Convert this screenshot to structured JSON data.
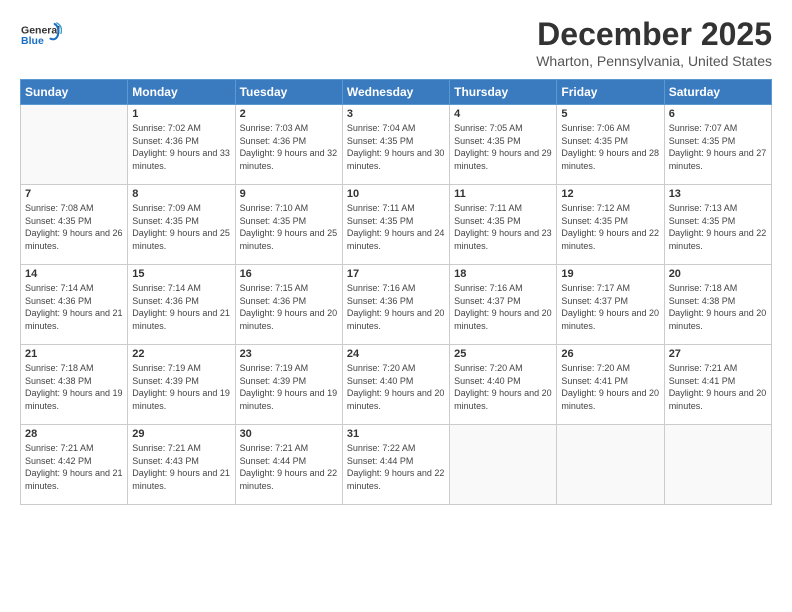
{
  "header": {
    "logo_general": "General",
    "logo_blue": "Blue",
    "month_title": "December 2025",
    "location": "Wharton, Pennsylvania, United States"
  },
  "columns": [
    "Sunday",
    "Monday",
    "Tuesday",
    "Wednesday",
    "Thursday",
    "Friday",
    "Saturday"
  ],
  "weeks": [
    [
      {
        "day": "",
        "sunrise": "",
        "sunset": "",
        "daylight": ""
      },
      {
        "day": "1",
        "sunrise": "Sunrise: 7:02 AM",
        "sunset": "Sunset: 4:36 PM",
        "daylight": "Daylight: 9 hours and 33 minutes."
      },
      {
        "day": "2",
        "sunrise": "Sunrise: 7:03 AM",
        "sunset": "Sunset: 4:36 PM",
        "daylight": "Daylight: 9 hours and 32 minutes."
      },
      {
        "day": "3",
        "sunrise": "Sunrise: 7:04 AM",
        "sunset": "Sunset: 4:35 PM",
        "daylight": "Daylight: 9 hours and 30 minutes."
      },
      {
        "day": "4",
        "sunrise": "Sunrise: 7:05 AM",
        "sunset": "Sunset: 4:35 PM",
        "daylight": "Daylight: 9 hours and 29 minutes."
      },
      {
        "day": "5",
        "sunrise": "Sunrise: 7:06 AM",
        "sunset": "Sunset: 4:35 PM",
        "daylight": "Daylight: 9 hours and 28 minutes."
      },
      {
        "day": "6",
        "sunrise": "Sunrise: 7:07 AM",
        "sunset": "Sunset: 4:35 PM",
        "daylight": "Daylight: 9 hours and 27 minutes."
      }
    ],
    [
      {
        "day": "7",
        "sunrise": "Sunrise: 7:08 AM",
        "sunset": "Sunset: 4:35 PM",
        "daylight": "Daylight: 9 hours and 26 minutes."
      },
      {
        "day": "8",
        "sunrise": "Sunrise: 7:09 AM",
        "sunset": "Sunset: 4:35 PM",
        "daylight": "Daylight: 9 hours and 25 minutes."
      },
      {
        "day": "9",
        "sunrise": "Sunrise: 7:10 AM",
        "sunset": "Sunset: 4:35 PM",
        "daylight": "Daylight: 9 hours and 25 minutes."
      },
      {
        "day": "10",
        "sunrise": "Sunrise: 7:11 AM",
        "sunset": "Sunset: 4:35 PM",
        "daylight": "Daylight: 9 hours and 24 minutes."
      },
      {
        "day": "11",
        "sunrise": "Sunrise: 7:11 AM",
        "sunset": "Sunset: 4:35 PM",
        "daylight": "Daylight: 9 hours and 23 minutes."
      },
      {
        "day": "12",
        "sunrise": "Sunrise: 7:12 AM",
        "sunset": "Sunset: 4:35 PM",
        "daylight": "Daylight: 9 hours and 22 minutes."
      },
      {
        "day": "13",
        "sunrise": "Sunrise: 7:13 AM",
        "sunset": "Sunset: 4:35 PM",
        "daylight": "Daylight: 9 hours and 22 minutes."
      }
    ],
    [
      {
        "day": "14",
        "sunrise": "Sunrise: 7:14 AM",
        "sunset": "Sunset: 4:36 PM",
        "daylight": "Daylight: 9 hours and 21 minutes."
      },
      {
        "day": "15",
        "sunrise": "Sunrise: 7:14 AM",
        "sunset": "Sunset: 4:36 PM",
        "daylight": "Daylight: 9 hours and 21 minutes."
      },
      {
        "day": "16",
        "sunrise": "Sunrise: 7:15 AM",
        "sunset": "Sunset: 4:36 PM",
        "daylight": "Daylight: 9 hours and 20 minutes."
      },
      {
        "day": "17",
        "sunrise": "Sunrise: 7:16 AM",
        "sunset": "Sunset: 4:36 PM",
        "daylight": "Daylight: 9 hours and 20 minutes."
      },
      {
        "day": "18",
        "sunrise": "Sunrise: 7:16 AM",
        "sunset": "Sunset: 4:37 PM",
        "daylight": "Daylight: 9 hours and 20 minutes."
      },
      {
        "day": "19",
        "sunrise": "Sunrise: 7:17 AM",
        "sunset": "Sunset: 4:37 PM",
        "daylight": "Daylight: 9 hours and 20 minutes."
      },
      {
        "day": "20",
        "sunrise": "Sunrise: 7:18 AM",
        "sunset": "Sunset: 4:38 PM",
        "daylight": "Daylight: 9 hours and 20 minutes."
      }
    ],
    [
      {
        "day": "21",
        "sunrise": "Sunrise: 7:18 AM",
        "sunset": "Sunset: 4:38 PM",
        "daylight": "Daylight: 9 hours and 19 minutes."
      },
      {
        "day": "22",
        "sunrise": "Sunrise: 7:19 AM",
        "sunset": "Sunset: 4:39 PM",
        "daylight": "Daylight: 9 hours and 19 minutes."
      },
      {
        "day": "23",
        "sunrise": "Sunrise: 7:19 AM",
        "sunset": "Sunset: 4:39 PM",
        "daylight": "Daylight: 9 hours and 19 minutes."
      },
      {
        "day": "24",
        "sunrise": "Sunrise: 7:20 AM",
        "sunset": "Sunset: 4:40 PM",
        "daylight": "Daylight: 9 hours and 20 minutes."
      },
      {
        "day": "25",
        "sunrise": "Sunrise: 7:20 AM",
        "sunset": "Sunset: 4:40 PM",
        "daylight": "Daylight: 9 hours and 20 minutes."
      },
      {
        "day": "26",
        "sunrise": "Sunrise: 7:20 AM",
        "sunset": "Sunset: 4:41 PM",
        "daylight": "Daylight: 9 hours and 20 minutes."
      },
      {
        "day": "27",
        "sunrise": "Sunrise: 7:21 AM",
        "sunset": "Sunset: 4:41 PM",
        "daylight": "Daylight: 9 hours and 20 minutes."
      }
    ],
    [
      {
        "day": "28",
        "sunrise": "Sunrise: 7:21 AM",
        "sunset": "Sunset: 4:42 PM",
        "daylight": "Daylight: 9 hours and 21 minutes."
      },
      {
        "day": "29",
        "sunrise": "Sunrise: 7:21 AM",
        "sunset": "Sunset: 4:43 PM",
        "daylight": "Daylight: 9 hours and 21 minutes."
      },
      {
        "day": "30",
        "sunrise": "Sunrise: 7:21 AM",
        "sunset": "Sunset: 4:44 PM",
        "daylight": "Daylight: 9 hours and 22 minutes."
      },
      {
        "day": "31",
        "sunrise": "Sunrise: 7:22 AM",
        "sunset": "Sunset: 4:44 PM",
        "daylight": "Daylight: 9 hours and 22 minutes."
      },
      {
        "day": "",
        "sunrise": "",
        "sunset": "",
        "daylight": ""
      },
      {
        "day": "",
        "sunrise": "",
        "sunset": "",
        "daylight": ""
      },
      {
        "day": "",
        "sunrise": "",
        "sunset": "",
        "daylight": ""
      }
    ]
  ]
}
